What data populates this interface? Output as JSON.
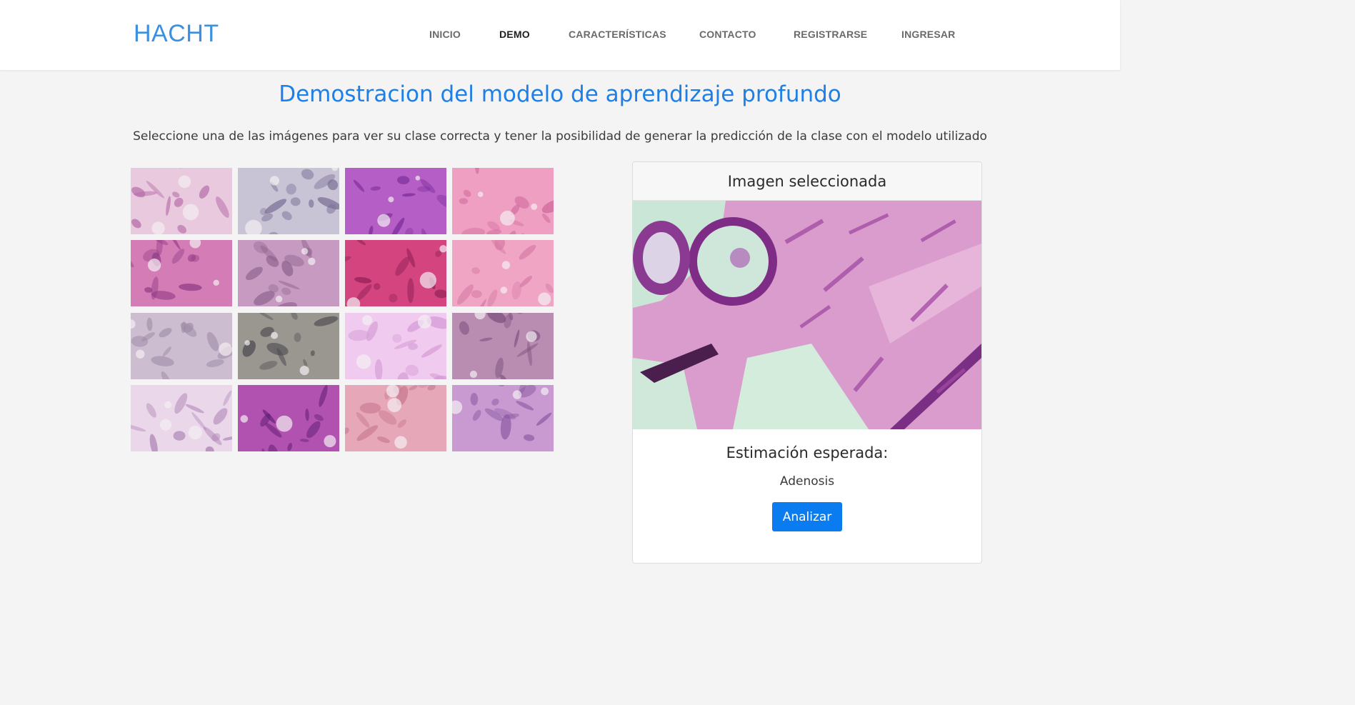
{
  "brand": "HACHT",
  "nav": {
    "items": [
      {
        "label": "INICIO",
        "active": false
      },
      {
        "label": "DEMO",
        "active": true
      },
      {
        "label": "CARACTERÍSTICAS",
        "active": false
      },
      {
        "label": "CONTACTO",
        "active": false
      },
      {
        "label": "REGISTRARSE",
        "active": false
      },
      {
        "label": "INGRESAR",
        "active": false
      }
    ]
  },
  "main": {
    "title": "Demostracion del modelo de aprendizaje profundo",
    "subtitle": "Seleccione una de las imágenes para ver su clase correcta y tener la posibilidad de generar la predicción de la clase con el modelo utilizado"
  },
  "gallery": {
    "thumbnails": [
      {
        "icon": "histology-image",
        "base": "#e9c9dd",
        "accent": "#b46aa8"
      },
      {
        "icon": "histology-image",
        "base": "#c9c3d6",
        "accent": "#7a6f94"
      },
      {
        "icon": "histology-image",
        "base": "#b45ec6",
        "accent": "#7b2c9b"
      },
      {
        "icon": "histology-image",
        "base": "#ee9fc2",
        "accent": "#d06a9c"
      },
      {
        "icon": "histology-image",
        "base": "#d47cb5",
        "accent": "#8f3a86"
      },
      {
        "icon": "histology-image",
        "base": "#c79bc1",
        "accent": "#8a5f8c"
      },
      {
        "icon": "histology-image",
        "base": "#d4457f",
        "accent": "#8e1e55"
      },
      {
        "icon": "histology-image",
        "base": "#f0a5c5",
        "accent": "#d67aa5"
      },
      {
        "icon": "histology-image",
        "base": "#cdbdd0",
        "accent": "#9b87a3"
      },
      {
        "icon": "histology-image",
        "base": "#9a9690",
        "accent": "#4c4a4f"
      },
      {
        "icon": "histology-image",
        "base": "#f1cbef",
        "accent": "#d49bd6"
      },
      {
        "icon": "histology-image",
        "base": "#b98cb2",
        "accent": "#7a4f7c"
      },
      {
        "icon": "histology-image",
        "base": "#ebd7ea",
        "accent": "#a77cb1"
      },
      {
        "icon": "histology-image",
        "base": "#b252b0",
        "accent": "#5e1e75"
      },
      {
        "icon": "histology-image",
        "base": "#e6a7b8",
        "accent": "#c97a92"
      },
      {
        "icon": "histology-image",
        "base": "#c99ad2",
        "accent": "#8a5aa0"
      }
    ]
  },
  "panel": {
    "header": "Imagen seleccionada",
    "estimate_title": "Estimación esperada:",
    "estimate_value": "Adenosis",
    "analyze_label": "Analizar"
  },
  "colors": {
    "brand": "#3d8fe0",
    "title": "#1e7fe6",
    "button": "#0b7bf0"
  }
}
